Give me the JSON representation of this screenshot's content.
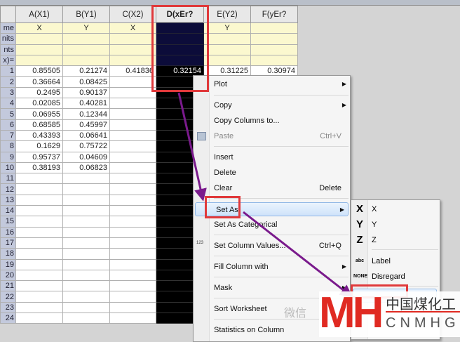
{
  "worksheet": {
    "columns": [
      "A(X1)",
      "B(Y1)",
      "C(X2)",
      "D(xEr?",
      "E(Y2)",
      "F(yEr?"
    ],
    "meta_rows": [
      {
        "label": "me",
        "values": [
          "X",
          "Y",
          "X",
          "",
          "Y",
          ""
        ]
      },
      {
        "label": "nits",
        "values": [
          "",
          "",
          "",
          "",
          "",
          ""
        ]
      },
      {
        "label": "nts",
        "values": [
          "",
          "",
          "",
          "",
          "",
          ""
        ]
      },
      {
        "label": "x)=",
        "values": [
          "",
          "",
          "",
          "",
          "",
          ""
        ]
      }
    ],
    "rows": [
      [
        "1",
        "0.85505",
        "0.21274",
        "0.41836",
        "0.32154",
        "0.31225",
        "0.30974"
      ],
      [
        "2",
        "0.36664",
        "0.08425",
        "",
        "",
        "",
        ""
      ],
      [
        "3",
        "0.2495",
        "0.90137",
        "",
        "",
        "",
        ""
      ],
      [
        "4",
        "0.02085",
        "0.40281",
        "",
        "",
        "",
        ""
      ],
      [
        "5",
        "0.06955",
        "0.12344",
        "",
        "",
        "",
        ""
      ],
      [
        "6",
        "0.68585",
        "0.45997",
        "",
        "",
        "",
        ""
      ],
      [
        "7",
        "0.43393",
        "0.06641",
        "",
        "",
        "",
        ""
      ],
      [
        "8",
        "0.1629",
        "0.75722",
        "",
        "",
        "",
        ""
      ],
      [
        "9",
        "0.95737",
        "0.04609",
        "",
        "",
        "",
        ""
      ],
      [
        "10",
        "0.38193",
        "0.06823",
        "",
        "",
        "",
        ""
      ],
      [
        "11",
        "",
        "",
        "",
        "",
        "",
        ""
      ],
      [
        "12",
        "",
        "",
        "",
        "",
        "",
        ""
      ],
      [
        "13",
        "",
        "",
        "",
        "",
        "",
        ""
      ],
      [
        "14",
        "",
        "",
        "",
        "",
        "",
        ""
      ],
      [
        "15",
        "",
        "",
        "",
        "",
        "",
        ""
      ],
      [
        "16",
        "",
        "",
        "",
        "",
        "",
        ""
      ],
      [
        "17",
        "",
        "",
        "",
        "",
        "",
        ""
      ],
      [
        "18",
        "",
        "",
        "",
        "",
        "",
        ""
      ],
      [
        "19",
        "",
        "",
        "",
        "",
        "",
        ""
      ],
      [
        "20",
        "",
        "",
        "",
        "",
        "",
        ""
      ],
      [
        "21",
        "",
        "",
        "",
        "",
        "",
        ""
      ],
      [
        "22",
        "",
        "",
        "",
        "",
        "",
        ""
      ],
      [
        "23",
        "",
        "",
        "",
        "",
        "",
        ""
      ],
      [
        "24",
        "",
        "",
        "",
        "",
        "",
        ""
      ]
    ]
  },
  "context_menu": {
    "items": [
      {
        "label": "Plot",
        "submenu": true
      },
      {
        "label": "Copy",
        "submenu": true
      },
      {
        "label": "Copy Columns to..."
      },
      {
        "label": "Paste",
        "shortcut": "Ctrl+V",
        "disabled": true
      },
      {
        "label": "Insert"
      },
      {
        "label": "Delete"
      },
      {
        "label": "Clear",
        "shortcut": "Delete"
      },
      {
        "label": "Set As",
        "submenu": true,
        "highlighted": true
      },
      {
        "label": "Set As Categorical"
      },
      {
        "label": "Set Column Values...",
        "shortcut": "Ctrl+Q"
      },
      {
        "label": "Fill Column with",
        "submenu": true
      },
      {
        "label": "Mask",
        "submenu": true
      },
      {
        "label": "Sort Worksheet"
      },
      {
        "label": "Statistics on Column"
      }
    ]
  },
  "set_as_submenu": {
    "items": [
      {
        "icon": "X",
        "label": "X"
      },
      {
        "icon": "Y",
        "label": "Y"
      },
      {
        "icon": "Z",
        "label": "Z"
      },
      {
        "icon": "abc",
        "label": "Label"
      },
      {
        "icon": "NONE",
        "label": "Disregard"
      }
    ]
  },
  "watermark": {
    "logo": "MH",
    "cn": "中国煤化工",
    "en": "CNMHG",
    "wechat": "微信"
  },
  "colors": {
    "highlight_box": "#e0393b",
    "arrow": "#7a1a8c"
  }
}
